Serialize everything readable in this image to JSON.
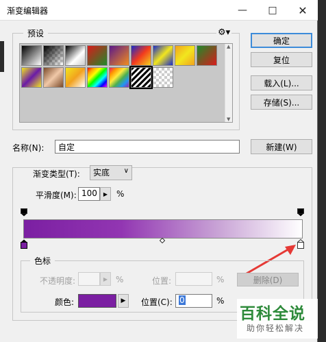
{
  "window": {
    "title": "渐变编辑器",
    "min_icon": "minimize-icon",
    "max_icon": "maximize-icon",
    "close_icon": "close-icon"
  },
  "presets": {
    "legend": "预设",
    "gear_icon": "gear-icon"
  },
  "buttons": {
    "ok": "确定",
    "reset": "复位",
    "load": "载入(L)...",
    "save": "存储(S)...",
    "new": "新建(W)",
    "delete": "删除(D)"
  },
  "name": {
    "label": "名称(N):",
    "value": "自定"
  },
  "gradient": {
    "type_label": "渐变类型(T):",
    "type_value": "实底",
    "smooth_label": "平滑度(M):",
    "smooth_value": "100",
    "smooth_unit": "%",
    "colors": {
      "start": "#7b1fa2",
      "end": "#ffffff"
    }
  },
  "stops": {
    "legend": "色标",
    "opacity_label": "不透明度:",
    "opacity_unit": "%",
    "location_label_top": "位置:",
    "location_unit_top": "%",
    "color_label": "颜色:",
    "color_value": "#7b1fa2",
    "location_label": "位置(C):",
    "location_value": "0",
    "location_unit": "%"
  },
  "watermark": {
    "main": "百科全说",
    "sub": "助你轻松解决"
  }
}
